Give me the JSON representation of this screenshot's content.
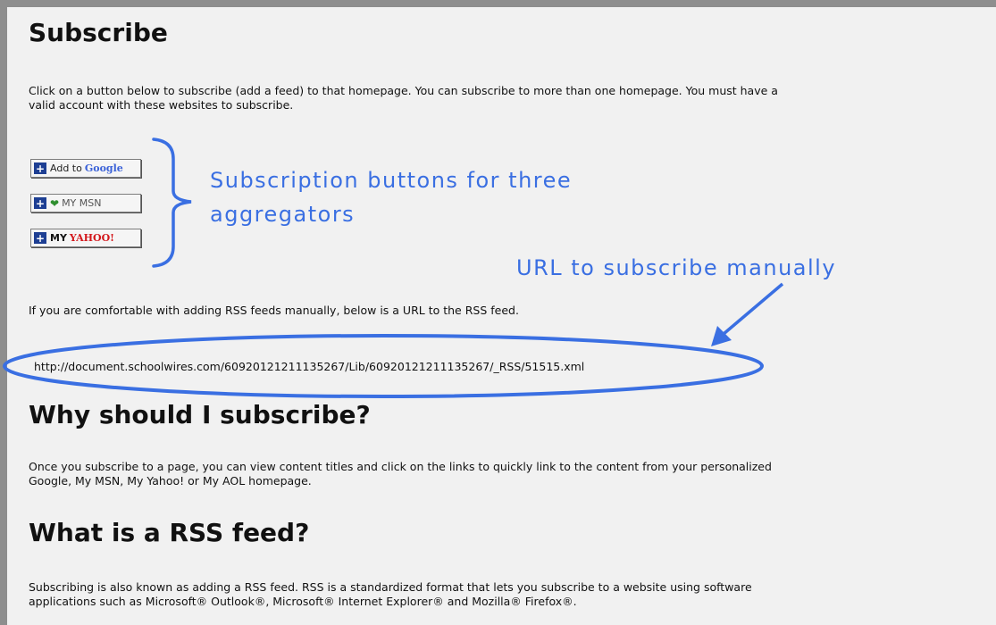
{
  "section_subscribe": {
    "heading": "Subscribe",
    "intro_line1": "Click on a button below to subscribe (add a feed) to that homepage. You can subscribe to more than one homepage. You must have a",
    "intro_line2": "valid account with these websites to subscribe."
  },
  "buttons": {
    "google": {
      "prefix": "Add to",
      "brand": "Google"
    },
    "msn": {
      "prefix": "MY MSN"
    },
    "yahoo": {
      "prefix": "MY",
      "brand": "YAHOO!"
    }
  },
  "annotations": {
    "buttons_line1": "Subscription buttons for three",
    "buttons_line2": "aggregators",
    "url_label": "URL to subscribe manually",
    "colors": {
      "annotation": "#3a6fe2"
    }
  },
  "manual": {
    "text": "If you are comfortable with adding RSS feeds manually, below is a URL to the RSS feed.",
    "url": "http://document.schoolwires.com/60920121211135267/Lib/60920121211135267/_RSS/51515.xml"
  },
  "section_why": {
    "heading": "Why should I subscribe?",
    "line1": "Once you subscribe to a page, you can view content titles and click on the links to quickly link to the content from your personalized",
    "line2": "Google, My MSN, My Yahoo! or My AOL homepage."
  },
  "section_rss": {
    "heading": "What is a RSS feed?",
    "line1": "Subscribing is also known as adding a RSS feed. RSS is a standardized format that lets you subscribe to a website using software",
    "line2": "applications such as Microsoft® Outlook®, Microsoft® Internet Explorer® and Mozilla® Firefox®."
  }
}
